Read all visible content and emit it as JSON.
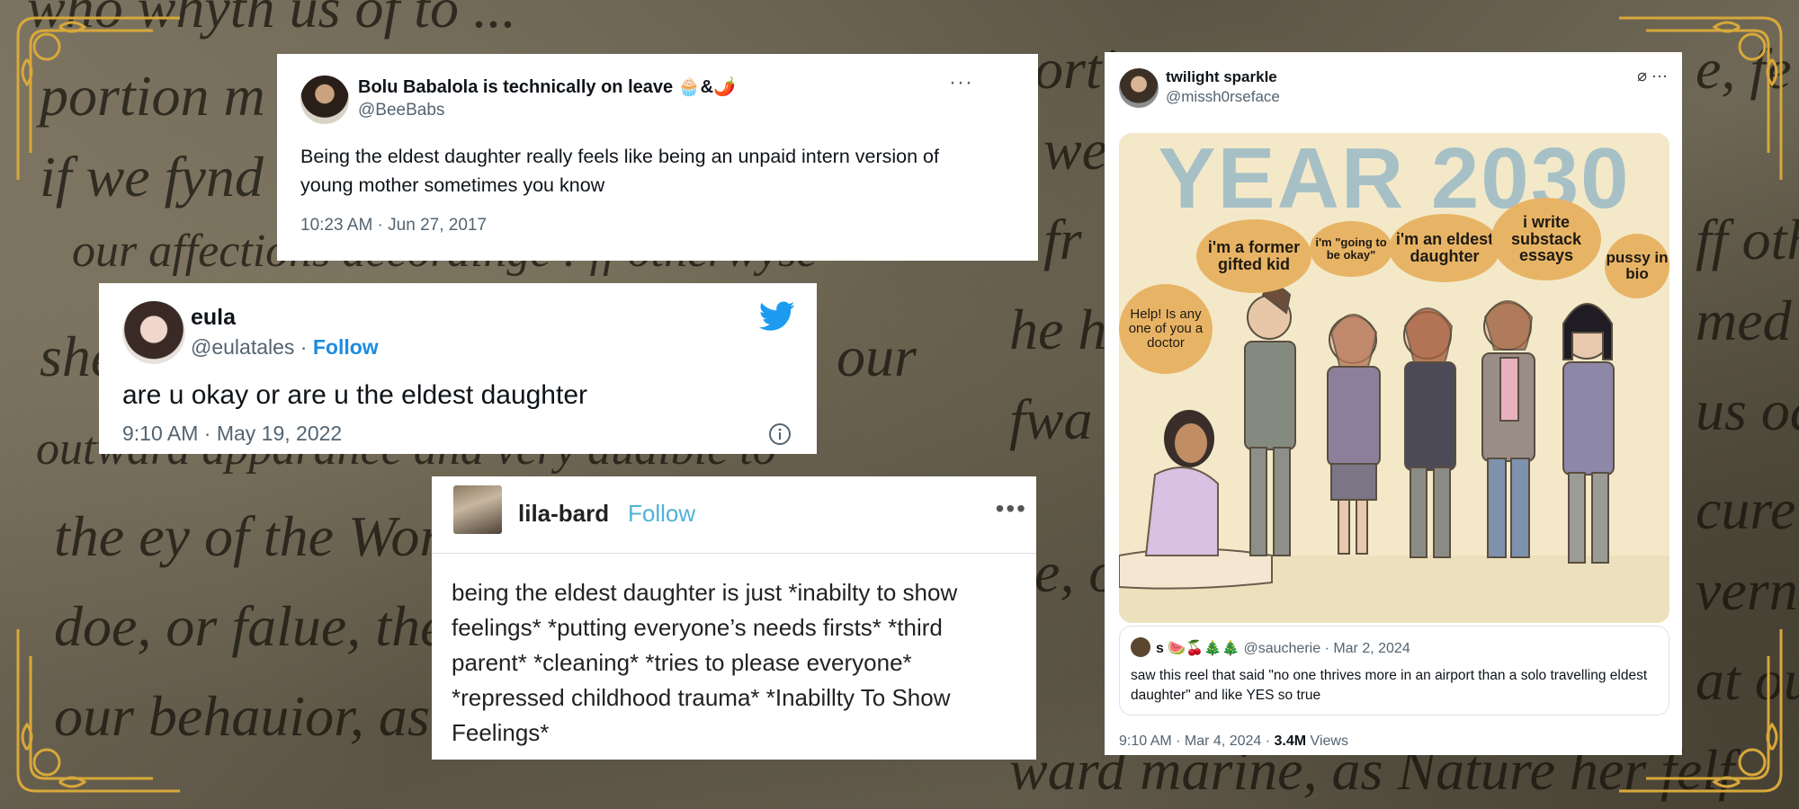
{
  "background_script": [
    "who whyth us of to ...",
    "portion m",
    "if we fynd",
    "our affections accordinge : ff otherwyse",
    "she",
    "our",
    "outward apparance and very audible to",
    "the ey of the World",
    "doe, or falue, the fa",
    "our behauior, as",
    "ortion a",
    "we",
    "fr",
    "he h",
    "fwa",
    "e, o",
    "ward marine, as Nature her felf",
    "e, fe",
    "ff oth",
    "med o",
    "us od",
    "cure",
    "vern a",
    "at ou"
  ],
  "tweet1": {
    "name": "Bolu Babalola is technically on leave 🧁&🌶️",
    "handle": "@BeeBabs",
    "text": "Being the eldest daughter really feels like being an unpaid intern version of young mother sometimes you know",
    "timestamp": "10:23 AM · Jun 27, 2017",
    "more_icon": "more-dots-icon"
  },
  "tweet2": {
    "name": "eula",
    "handle": "@eulatales",
    "separator": " · ",
    "follow": "Follow",
    "text": "are u okay or are u the eldest daughter",
    "timestamp": "9:10 AM · May 19, 2022",
    "brand_color": "#1d9bf0",
    "icons": [
      "twitter-bird-icon",
      "info-icon"
    ]
  },
  "tumblr_post": {
    "name": "lila-bard",
    "follow": "Follow",
    "text": "being the eldest daughter is just *inabilty to show feelings* *putting everyone’s needs firsts* *third parent* *cleaning* *tries to please everyone* *repressed childhood trauma* *Inabillty To Show Feelings*",
    "more_icon": "more-dots-icon"
  },
  "tweet4": {
    "name": "twilight sparkle",
    "handle": "@missh0rseface",
    "image": {
      "header": "YEAR 2030",
      "bubbles": [
        "Help! Is any one of you a doctor",
        "i'm a former gifted kid",
        "i'm \"going to be okay\"",
        "i'm an eldest daughter",
        "i write substack essays",
        "pussy in bio"
      ]
    },
    "quote": {
      "name": "s 🍉🍒🎄🎄",
      "handle": "@saucherie",
      "separator": " · ",
      "date": "Mar 2, 2024",
      "text": "saw this reel that said \"no one thrives more in an airport than a solo travelling eldest daughter\" and like YES so true"
    },
    "meta": {
      "time": "9:10 AM · Mar 4, 2024 · ",
      "views_count": "3.4M",
      "views_label": " Views"
    }
  }
}
